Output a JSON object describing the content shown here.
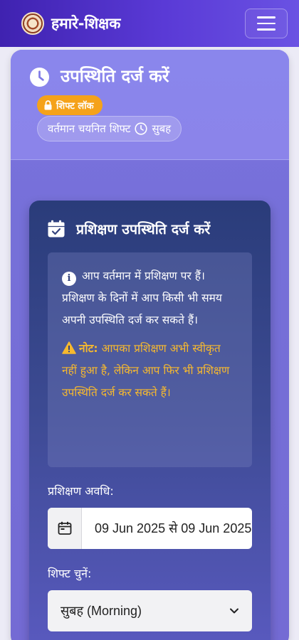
{
  "navbar": {
    "brand": "हमारे-शिक्षक"
  },
  "attendance_card": {
    "title": "उपस्थिति दर्ज करें",
    "lock_badge": "शिफ्ट लॉक",
    "current_shift_label": "वर्तमान चयनित शिफ्ट",
    "current_shift_value": "सुबह"
  },
  "training_card": {
    "title": "प्रशिक्षण उपस्थिति दर्ज करें",
    "info_text": "आप वर्तमान में प्रशिक्षण पर हैं। प्रशिक्षण के दिनों में आप किसी भी समय अपनी उपस्थिति दर्ज कर सकते हैं।",
    "note_label": "नोट:",
    "note_text": "आपका प्रशिक्षण अभी स्वीकृत नहीं हुआ है, लेकिन आप फिर भी प्रशिक्षण उपस्थिति दर्ज कर सकते हैं।",
    "period_label": "प्रशिक्षण अवधि:",
    "period_value": "09 Jun 2025 से 09 Jun 2025",
    "shift_select_label": "शिफ्ट चुनें:",
    "shift_selected": "सुबह (Morning)"
  },
  "icons": {
    "logo": "emblem-logo",
    "menu": "hamburger-icon",
    "clock": "clock-icon",
    "lock": "lock-icon",
    "calendar_check": "calendar-check-icon",
    "info": "info-icon",
    "warning": "warning-icon",
    "calendar": "calendar-icon",
    "chevron": "chevron-down-icon"
  },
  "colors": {
    "navbar": "#4a2cc4",
    "accent_orange": "#f5a21a",
    "note_yellow": "#f7b92e"
  }
}
